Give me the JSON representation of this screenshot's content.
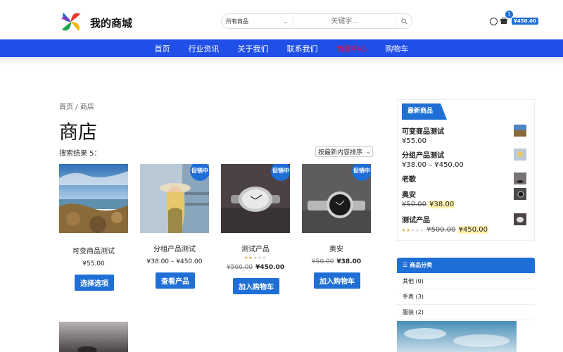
{
  "header": {
    "site_name": "我的商城",
    "search": {
      "category": "所有商品",
      "placeholder": "关键字..."
    },
    "cart": {
      "count": "1",
      "total": "¥450.00"
    }
  },
  "nav": {
    "items": [
      "首页",
      "行业资讯",
      "关于我们",
      "联系我们",
      "商家中心",
      "购物车"
    ],
    "active_index": 4
  },
  "colors": {
    "accent": "#1f6fd6",
    "nav_bg": "#1f4fe6",
    "nav_active": "#e8143c"
  },
  "breadcrumb": "首页 / 商店",
  "page_title": "商店",
  "results": "搜索结果 5：",
  "sort": {
    "selected": "按最新内容排序"
  },
  "products": [
    {
      "name": "可变商品测试",
      "price": "¥55.00",
      "button": "选择选项",
      "sale": ""
    },
    {
      "name": "分组产品测试",
      "price": "¥38.00 – ¥450.00",
      "button": "查看产品",
      "sale": "促销中"
    },
    {
      "name": "测试产品",
      "old_price": "¥500.00",
      "new_price": "¥450.00",
      "rating": 2,
      "button": "加入购物车",
      "sale": "促销中"
    },
    {
      "name": "奥安",
      "old_price": "¥50.00",
      "new_price": "¥38.00",
      "button": "加入购物车",
      "sale": "促销中"
    }
  ],
  "sidebar": {
    "latest_title": "最新商品",
    "latest": [
      {
        "name": "可变商品测试",
        "price": "¥55.00"
      },
      {
        "name": "分组产品测试",
        "price": "¥38.00 – ¥450.00"
      },
      {
        "name": "老歌",
        "price": ""
      },
      {
        "name": "奥安",
        "old_price": "¥50.00",
        "new_price": "¥38.00"
      },
      {
        "name": "测试产品",
        "old_price": "¥500.00",
        "new_price": "¥450.00",
        "rating": 2
      }
    ],
    "categories_title": "商品分类",
    "categories": [
      "其他 (0)",
      "手表 (3)",
      "服装 (2)"
    ]
  }
}
